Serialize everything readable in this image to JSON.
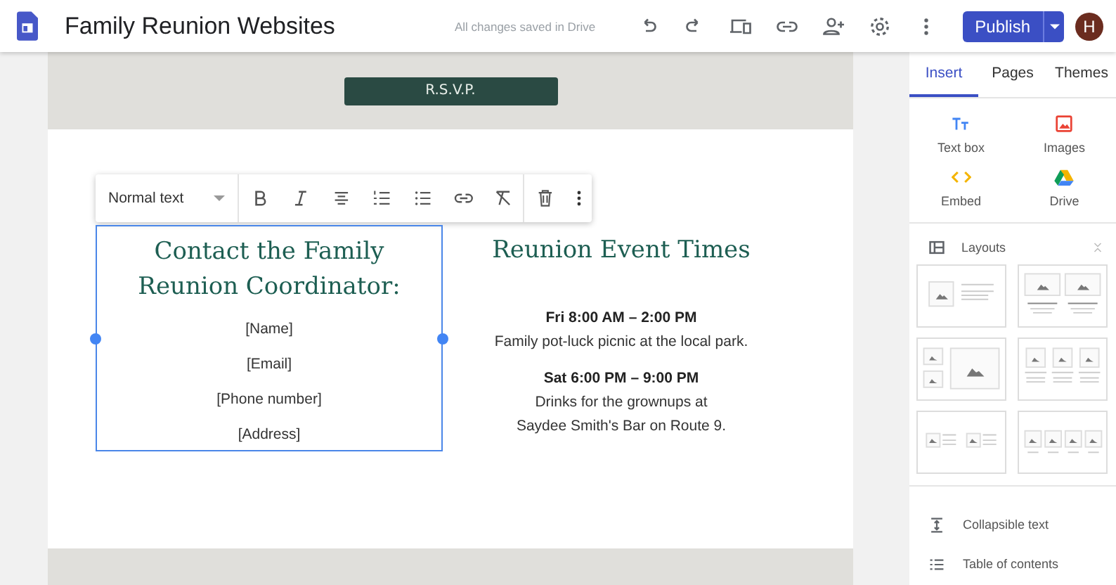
{
  "header": {
    "title": "Family Reunion Websites",
    "save_status": "All changes saved in Drive",
    "publish": "Publish",
    "avatar": "H"
  },
  "page": {
    "rsvp": "R.S.V.P.",
    "toolbar": {
      "style": "Normal text"
    },
    "contact": {
      "heading": "Contact the Family Reunion Coordinator:",
      "lines": [
        "[Name]",
        "[Email]",
        "[Phone number]",
        "[Address]"
      ],
      "selected": true
    },
    "events": {
      "heading": "Reunion Event Times",
      "items": [
        {
          "time": "Fri  8:00 AM – 2:00 PM",
          "lines": [
            "Family pot-luck picnic at the local park."
          ]
        },
        {
          "time": "Sat  6:00 PM – 9:00 PM",
          "lines": [
            "Drinks for the grownups at",
            "Saydee Smith's Bar on Route 9."
          ]
        }
      ]
    }
  },
  "panel": {
    "tabs": [
      {
        "label": "Insert",
        "selected": true
      },
      {
        "label": "Pages",
        "selected": false
      },
      {
        "label": "Themes",
        "selected": false
      }
    ],
    "insert_items": [
      {
        "kind": "textbox",
        "label": "Text box"
      },
      {
        "kind": "images",
        "label": "Images"
      },
      {
        "kind": "embed",
        "label": "Embed"
      },
      {
        "kind": "drive",
        "label": "Drive"
      }
    ],
    "layouts_label": "Layouts",
    "components": [
      {
        "kind": "collapsible",
        "label": "Collapsible text"
      },
      {
        "kind": "toc",
        "label": "Table of contents"
      }
    ]
  }
}
